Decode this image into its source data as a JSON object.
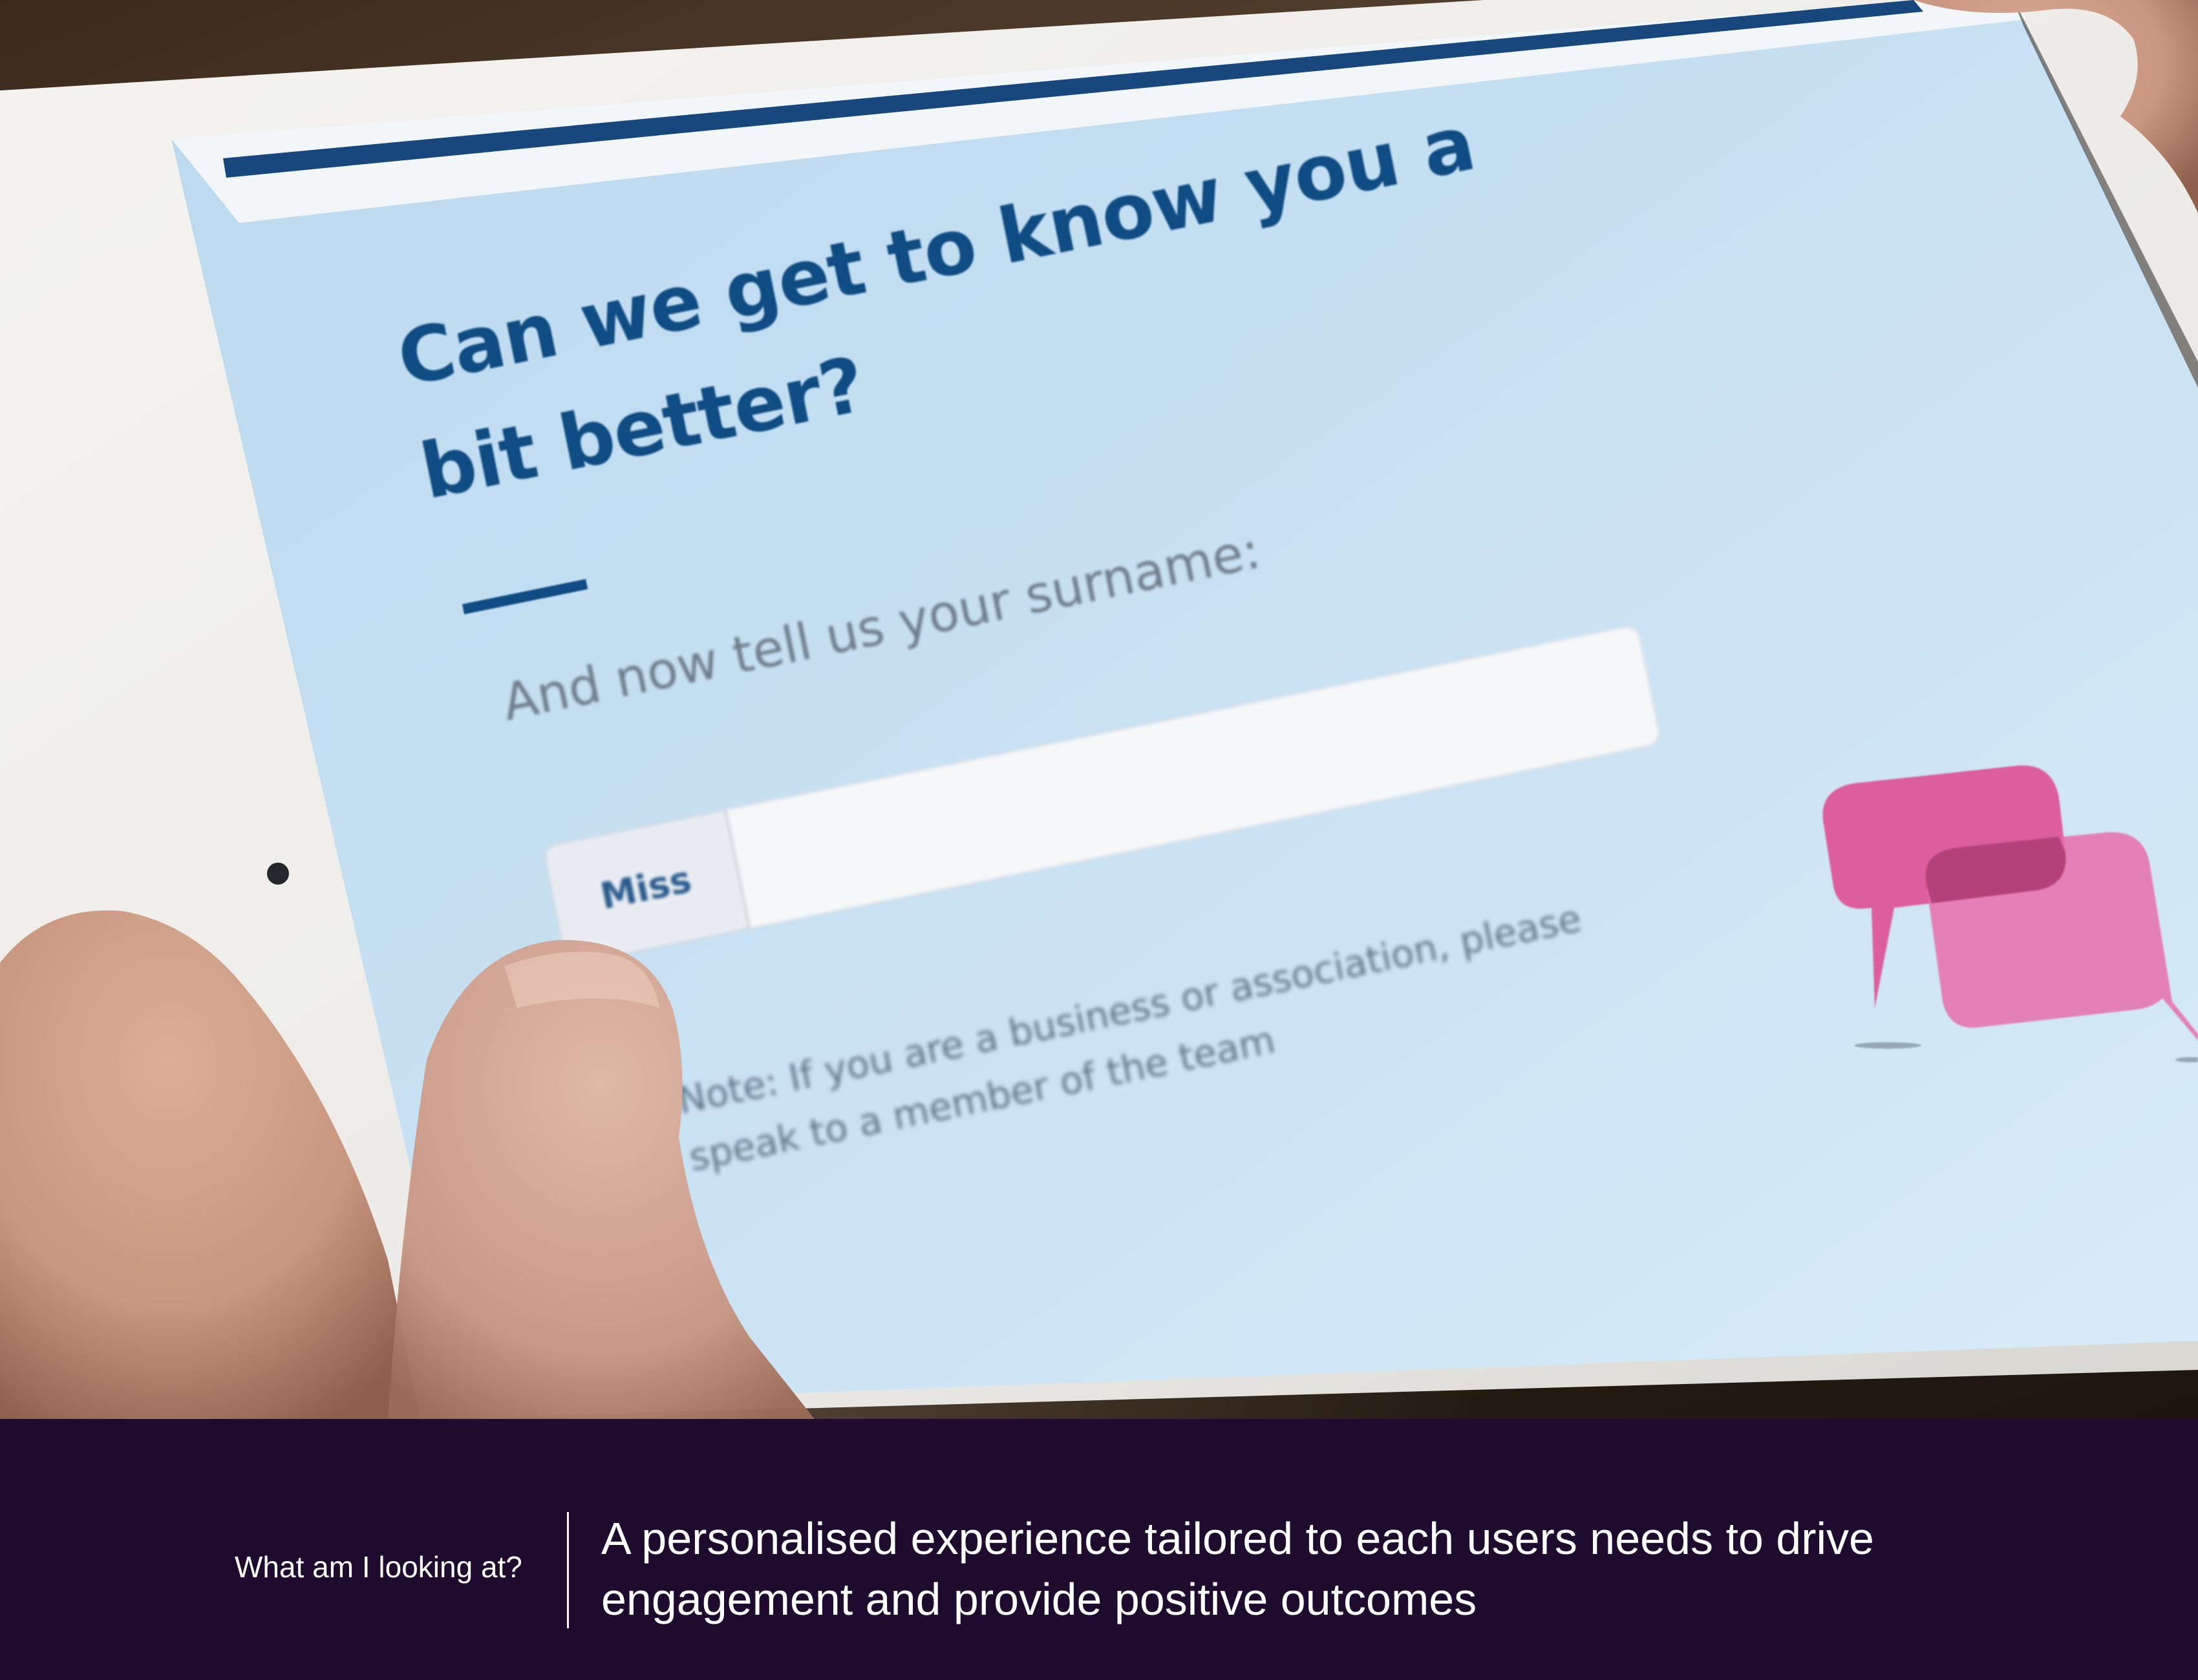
{
  "screen": {
    "title": "Can we get to know you a bit better?",
    "question": "And now tell us your surname:",
    "title_select_value": "Miss",
    "surname_value": "",
    "note": "Note: If you are a business or association, please speak to a member of the team"
  },
  "caption": {
    "label": "What am I looking at?",
    "text": "A personalised experience tailored to each users needs to drive engagement and provide positive outcomes"
  },
  "colors": {
    "screen_background": "#c9e2f4",
    "heading_blue": "#0f4c84",
    "bubble_pink": "#e0559a",
    "caption_background": "#1e0b2e"
  }
}
